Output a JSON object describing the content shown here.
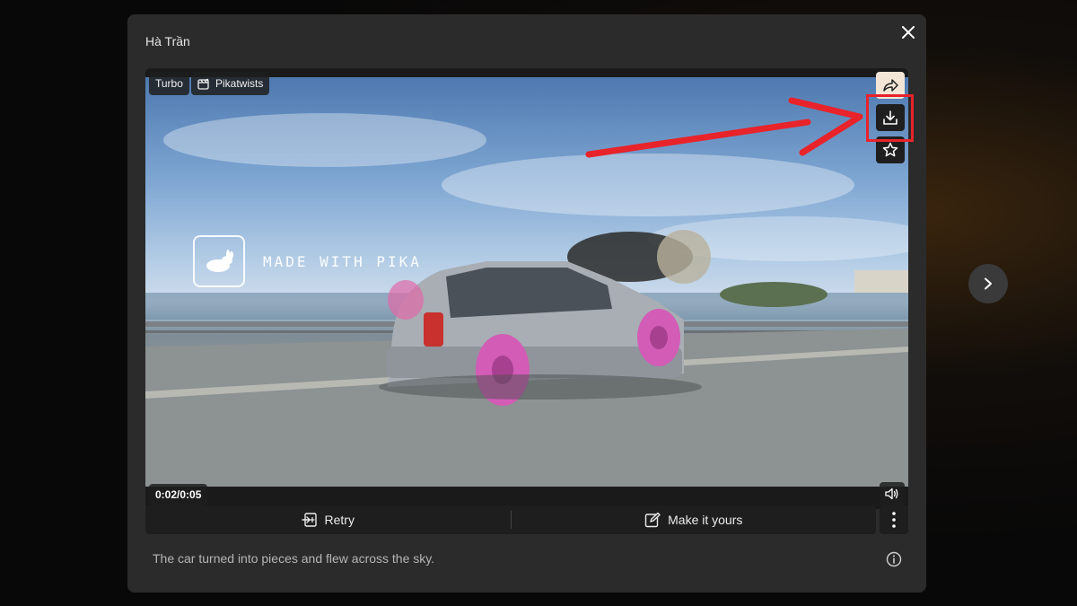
{
  "modal": {
    "title": "Hà Trần",
    "close_icon": "close-icon"
  },
  "video": {
    "tags": [
      {
        "label": "Turbo"
      },
      {
        "label": "Pikatwists",
        "icon": "pikatwists-icon"
      }
    ],
    "watermark_text": "MADE WITH PIKA",
    "time": "0:02/0:05",
    "progress": 0.4,
    "side_actions": [
      "share-icon",
      "download-icon",
      "star-icon"
    ],
    "volume_icon": "volume-icon"
  },
  "actions": {
    "retry_label": "Retry",
    "make_it_yours_label": "Make it yours",
    "more_icon": "more-vertical-icon"
  },
  "prompt_text": "The car turned into pieces and flew across the sky.",
  "info_icon": "info-icon",
  "next_icon": "chevron-right-icon",
  "colors": {
    "annotation": "#e8232a",
    "modal_bg": "#2b2b2b",
    "share_btn_bg": "#f3e6d6"
  }
}
